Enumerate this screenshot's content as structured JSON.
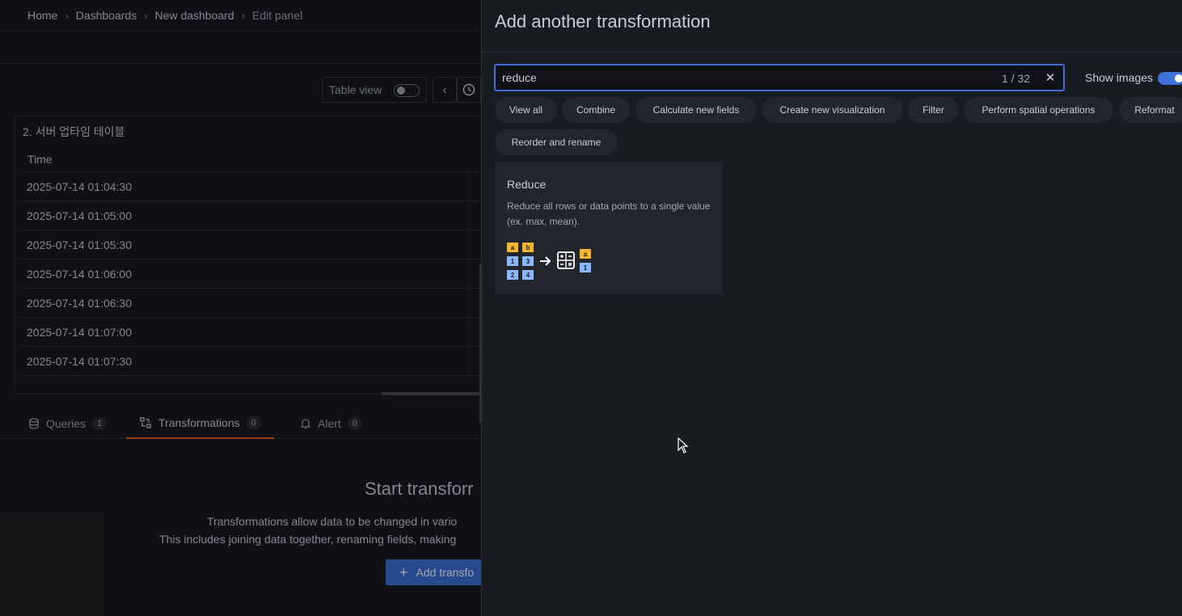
{
  "breadcrumb": [
    "Home",
    "Dashboards",
    "New dashboard",
    "Edit panel"
  ],
  "toolbar": {
    "table_view_label": "Table view"
  },
  "panel": {
    "title": "2. 서버 업타임 테이블",
    "column_header": "Time",
    "rows": [
      "2025-07-14 01:04:30",
      "2025-07-14 01:05:00",
      "2025-07-14 01:05:30",
      "2025-07-14 01:06:00",
      "2025-07-14 01:06:30",
      "2025-07-14 01:07:00",
      "2025-07-14 01:07:30"
    ]
  },
  "tabs": [
    {
      "label": "Queries",
      "count": "1"
    },
    {
      "label": "Transformations",
      "count": "0"
    },
    {
      "label": "Alert",
      "count": "0"
    }
  ],
  "empty_state": {
    "title": "Start transforr",
    "line1": "Transformations allow data to be changed in vario",
    "line2": "This includes joining data together, renaming fields, making",
    "button_label": "Add transfo"
  },
  "drawer": {
    "title": "Add another transformation",
    "search": {
      "value": "reduce",
      "count": "1 / 32"
    },
    "show_images_label": "Show images",
    "show_images_on": true,
    "filters": [
      "View all",
      "Combine",
      "Calculate new fields",
      "Create new visualization",
      "Filter",
      "Perform spatial operations",
      "Reformat",
      "Reorder and rename"
    ],
    "result_card": {
      "name": "Reduce",
      "description": "Reduce all rows or data points to a single value (ex. max, mean)."
    },
    "illustration": {
      "left_grid": [
        "a",
        "b",
        "1",
        "3",
        "2",
        "4"
      ],
      "right": [
        "a",
        "1"
      ]
    }
  },
  "colors": {
    "accent": "#3d71d9",
    "active_tab": "#f05a28",
    "illustration_yellow": "#f5b52f",
    "illustration_blue": "#8ab8ff"
  }
}
